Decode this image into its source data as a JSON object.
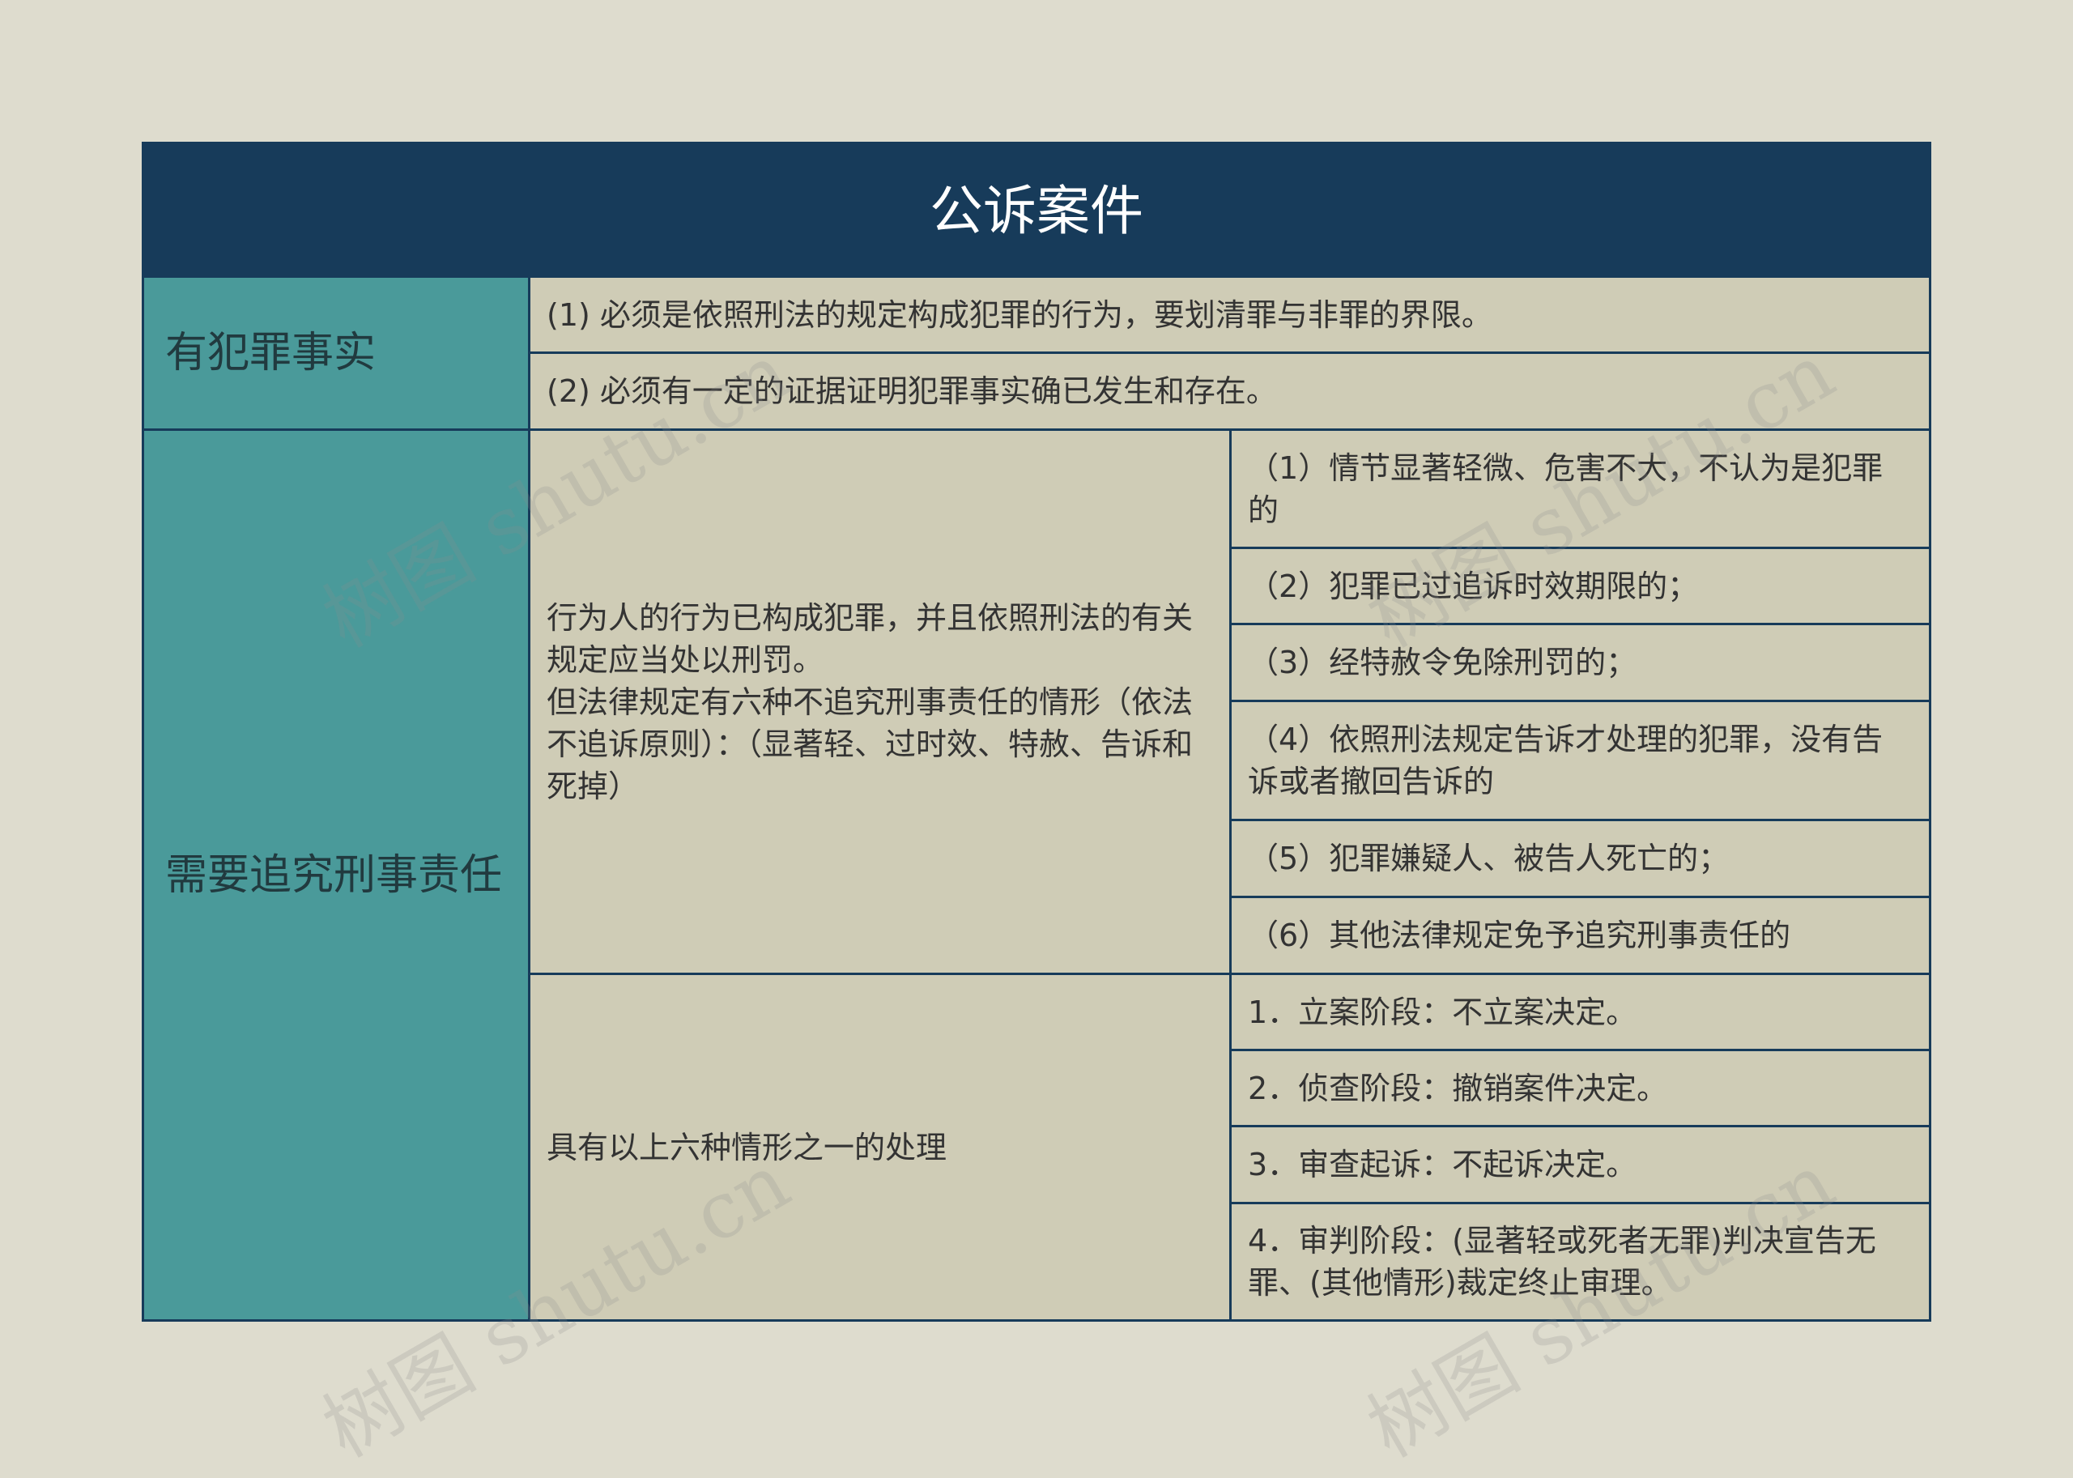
{
  "title": "公诉案件",
  "section1": {
    "label": "有犯罪事实",
    "items": [
      "(1) 必须是依照刑法的规定构成犯罪的行为，要划清罪与非罪的界限。",
      "(2) 必须有一定的证据证明犯罪事实确已发生和存在。"
    ]
  },
  "section2": {
    "label": "需要追究刑事责任",
    "description": "行为人的行为已构成犯罪，并且依照刑法的有关规定应当处以刑罚。\n但法律规定有六种不追究刑事责任的情形（依法不追诉原则）：（显著轻、过时效、特赦、告诉和死掉）",
    "cases": [
      "（1）情节显著轻微、危害不大，不认为是犯罪的",
      "（2）犯罪已过追诉时效期限的；",
      "（3）经特赦令免除刑罚的；",
      "（4）依照刑法规定告诉才处理的犯罪，没有告诉或者撤回告诉的",
      "（5）犯罪嫌疑人、被告人死亡的；",
      "（6）其他法律规定免予追究刑事责任的"
    ],
    "handling_label": "具有以上六种情形之一的处理",
    "handling": [
      "1．立案阶段：不立案决定。",
      "2．侦查阶段：撤销案件决定。",
      "3．审查起诉：不起诉决定。",
      "4．审判阶段：(显著轻或死者无罪)判决宣告无罪、(其他情形)裁定终止审理。"
    ]
  },
  "watermark": "树图 shutu.cn"
}
